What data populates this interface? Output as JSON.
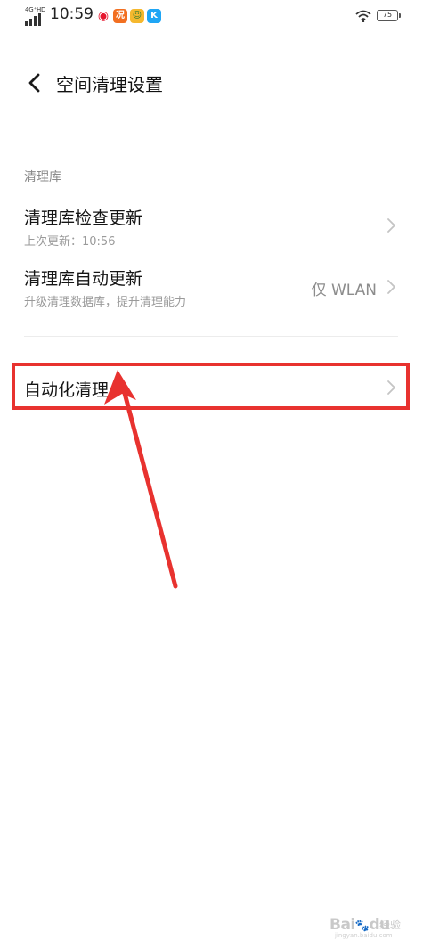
{
  "status_bar": {
    "network": "4G⁺HD",
    "time": "10:59",
    "weibo_icon": "weibo-icon",
    "app1_glyph": "况",
    "app2_glyph": "☺",
    "app3_glyph": "K",
    "battery": "75"
  },
  "header": {
    "title": "空间清理设置"
  },
  "section": {
    "label": "清理库"
  },
  "rows": [
    {
      "title": "清理库检查更新",
      "subtitle": "上次更新：10:56"
    },
    {
      "title": "清理库自动更新",
      "subtitle": "升级清理数据库，提升清理能力",
      "value": "仅 WLAN"
    },
    {
      "title": "自动化清理"
    }
  ],
  "annotation": {
    "color": "#e8322f"
  },
  "watermark": {
    "logo": "Bai",
    "logo_suffix": "du",
    "text": "经验",
    "url": "jingyan.baidu.com"
  }
}
